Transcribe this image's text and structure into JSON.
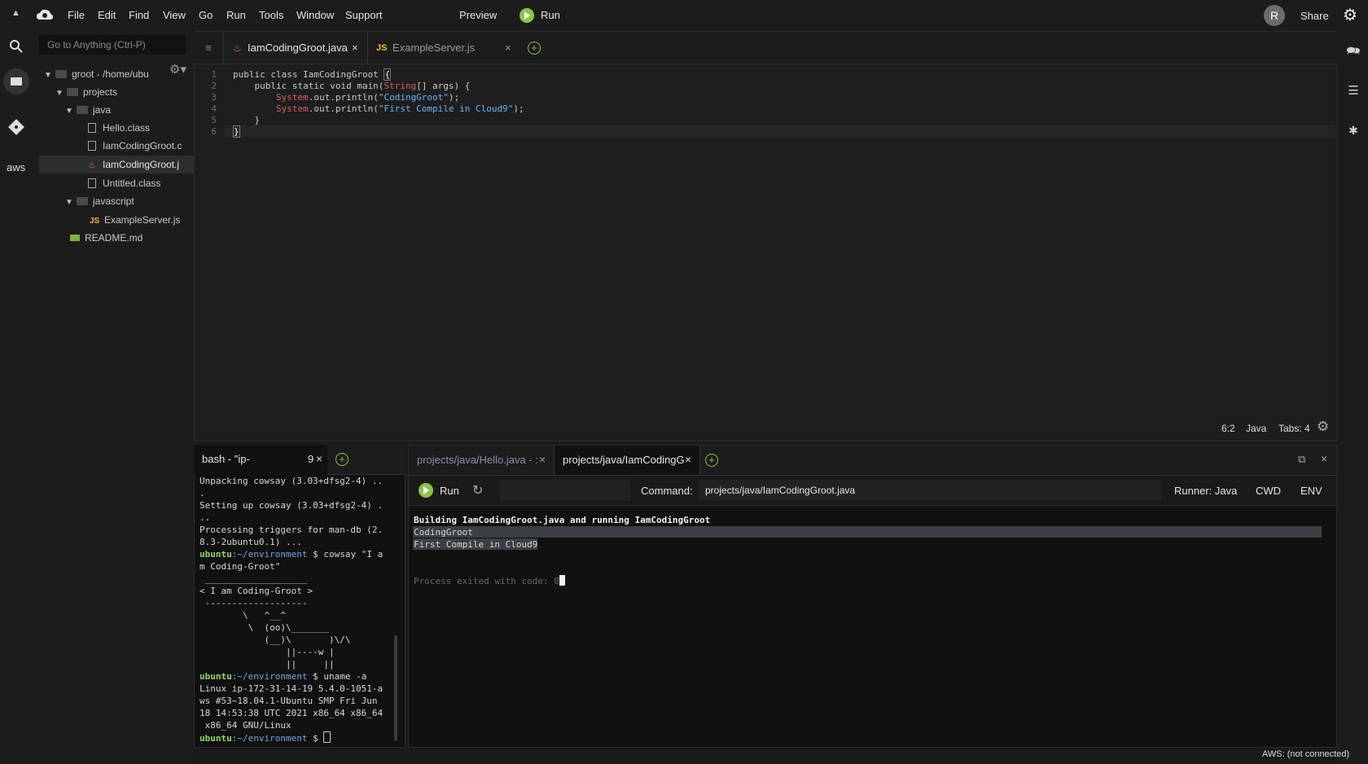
{
  "menubar": {
    "items": [
      "File",
      "Edit",
      "Find",
      "View",
      "Go",
      "Run",
      "Tools",
      "Window",
      "Support"
    ],
    "preview": "Preview",
    "run": "Run",
    "avatar": "R",
    "share": "Share"
  },
  "sidebar": {
    "aws": "aws"
  },
  "tree": {
    "goto_placeholder": "Go to Anything (Ctrl-P)",
    "root": "groot - /home/ubu",
    "projects": "projects",
    "java": "java",
    "files_java": [
      "Hello.class",
      "IamCodingGroot.c",
      "IamCodingGroot.j",
      "Untitled.class"
    ],
    "javascript": "javascript",
    "files_js": [
      "ExampleServer.js"
    ],
    "readme": "README.md"
  },
  "editor": {
    "tabs": [
      {
        "label": "IamCodingGroot.java",
        "icon": "java-icon",
        "active": true
      },
      {
        "label": "ExampleServer.js",
        "icon": "JS",
        "active": false
      }
    ],
    "code": {
      "l1a": "public class IamCodingGroot ",
      "l1b": "{",
      "l2a": "    public static void main(",
      "l2b": "String",
      "l2c": "[] args) {",
      "l3a": "        ",
      "l3b": "System",
      ".l3c": "",
      "l3d": ".out.println(",
      "l3e": "\"CodingGroot\"",
      "l3f": ");",
      "l4a": "        ",
      "l4b": "System",
      "l4d": ".out.println(",
      "l4e": "\"First Compile in Cloud9\"",
      "l4f": ");",
      "l5": "    }",
      "l6": "}"
    },
    "line_numbers": [
      "1",
      "2",
      "3",
      "4",
      "5",
      "6"
    ],
    "status": {
      "cursor": "6:2",
      "lang": "Java",
      "tabs": "Tabs: 4"
    }
  },
  "bash": {
    "tab": "bash - \"ip-",
    "tab_suffix": "9",
    "lines": [
      "Unpacking cowsay (3.03+dfsg2-4) ..",
      ".",
      "Setting up cowsay (3.03+dfsg2-4) .",
      "..",
      "Processing triggers for man-db (2.",
      "8.3-2ubuntu0.1) ...",
      "",
      "m Coding-Groot\"",
      " ___________________",
      "< I am Coding-Groot >",
      " -------------------",
      "        \\   ^__^",
      "         \\  (oo)\\_______",
      "            (__)\\       )\\/\\",
      "                ||----w |",
      "                ||     ||",
      "",
      "Linux ip-172-31-14-19 5.4.0-1051-a",
      "ws #53~18.04.1-Ubuntu SMP Fri Jun",
      "18 14:53:38 UTC 2021 x86_64 x86_64",
      " x86_64 GNU/Linux",
      ""
    ],
    "prompt_user": "ubuntu",
    "prompt_path": ":~/environment",
    "prompt_sym": " $ ",
    "cmd_cowsay": "cowsay \"I a",
    "cmd_uname": "uname -a"
  },
  "runner": {
    "tabs": [
      "projects/java/Hello.java - :",
      "projects/java/IamCodingG"
    ],
    "run": "Run",
    "command_label": "Command:",
    "command_value": "projects/java/IamCodingGroot.java",
    "runner_label": "Runner: Java",
    "cwd": "CWD",
    "env": "ENV",
    "output": [
      "Building IamCodingGroot.java and running IamCodingGroot",
      "CodingGroot",
      "First Compile in Cloud9"
    ],
    "exit": "Process exited with code: 0"
  },
  "statusbar": "AWS: (not connected)",
  "colors": {
    "accent_green": "#8bc34a",
    "bg": "#1a1a1a"
  }
}
